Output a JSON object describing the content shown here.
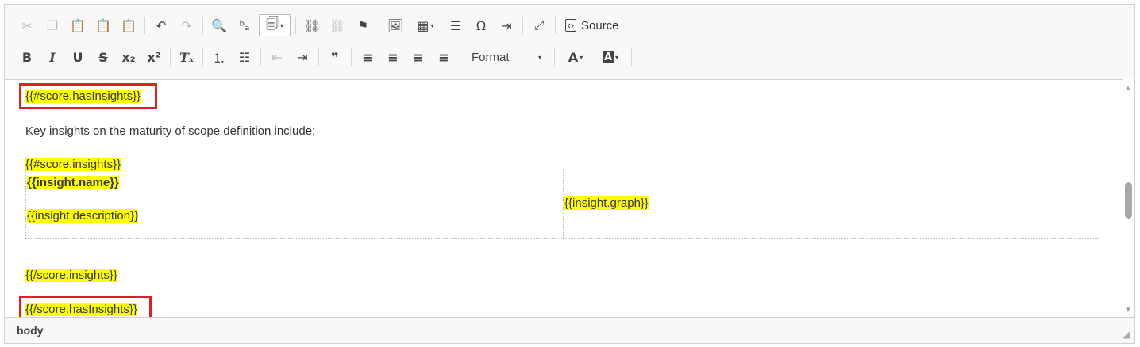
{
  "toolbar": {
    "row1": [
      {
        "name": "cut-icon",
        "glyph": "✂",
        "disabled": true
      },
      {
        "name": "copy-icon",
        "glyph": "❐",
        "disabled": true
      },
      {
        "name": "paste-icon",
        "glyph": "📋",
        "disabled": false
      },
      {
        "name": "paste-text-icon",
        "glyph": "📋",
        "disabled": false
      },
      {
        "name": "paste-from-word-icon",
        "glyph": "📋",
        "disabled": false
      },
      {
        "name": "undo-icon",
        "glyph": "↶",
        "disabled": false
      },
      {
        "name": "redo-icon",
        "glyph": "↷",
        "disabled": true
      },
      {
        "name": "find-icon",
        "glyph": "🔍",
        "disabled": false
      },
      {
        "name": "replace-icon",
        "glyph": "ᵇₐ",
        "disabled": false
      },
      {
        "name": "placeholder-icon",
        "glyph": "🗐",
        "disabled": false
      },
      {
        "name": "link-icon",
        "glyph": "⛓",
        "disabled": false
      },
      {
        "name": "unlink-icon",
        "glyph": "⛓",
        "disabled": true
      },
      {
        "name": "anchor-icon",
        "glyph": "⚑",
        "disabled": false
      },
      {
        "name": "image-icon",
        "glyph": "🖼",
        "disabled": false
      },
      {
        "name": "table-icon",
        "glyph": "▦",
        "disabled": false
      },
      {
        "name": "horizontal-line-icon",
        "glyph": "☰",
        "disabled": false
      },
      {
        "name": "special-char-icon",
        "glyph": "Ω",
        "disabled": false
      },
      {
        "name": "page-break-icon",
        "glyph": "⇥",
        "disabled": false
      },
      {
        "name": "maximize-icon",
        "glyph": "⤢",
        "disabled": false
      }
    ],
    "source_label": "Source",
    "format_label": "Format",
    "caret": "▾",
    "bold": "B",
    "italic": "I",
    "underline": "U",
    "strike": "S",
    "subscript": "x₂",
    "superscript": "x²",
    "remove_format": "Tₓ",
    "numbered_list": "⒈",
    "bulleted_list": "☷",
    "outdent": "⇤",
    "indent": "⇥",
    "blockquote": "❞",
    "align_left": "≡",
    "align_center": "≡",
    "align_right": "≡",
    "justify": "≡",
    "text_color": "A",
    "bg_color": "A"
  },
  "content": {
    "has_insights_open": "{{#score.hasInsights}}",
    "intro_text": "Key insights on the maturity of scope definition include:",
    "insights_open": "{{#score.insights}}",
    "insight_name": "{{insight.name}}",
    "insight_description": "{{insight.description}}",
    "insight_graph": "{{insight.graph}}",
    "insights_close": "{{/score.insights}}",
    "has_insights_close": "{{/score.hasInsights}}"
  },
  "statusbar": {
    "path": "body"
  }
}
